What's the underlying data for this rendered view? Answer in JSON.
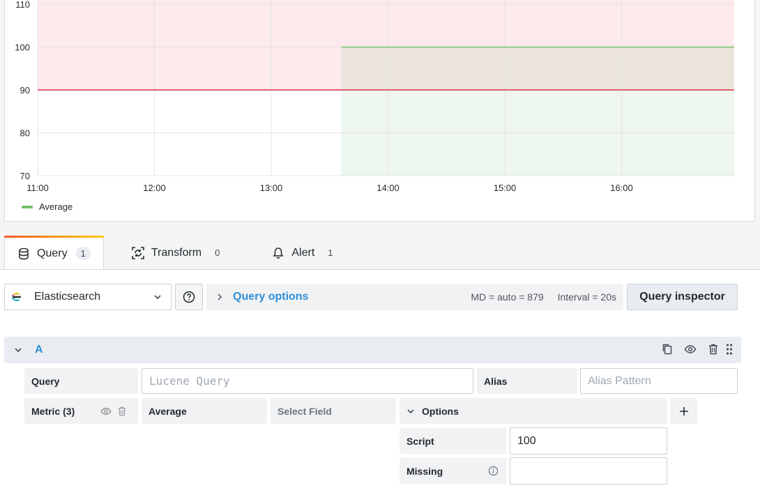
{
  "chart_data": {
    "type": "line",
    "x_ticks": [
      "11:00",
      "12:00",
      "13:00",
      "14:00",
      "15:00",
      "16:00"
    ],
    "y_ticks": [
      70,
      80,
      90,
      100,
      110
    ],
    "ylim": [
      70,
      113
    ],
    "series": [
      {
        "name": "Average",
        "color": "#73bf69",
        "x": [
          "13:36",
          "16:58"
        ],
        "values": [
          100,
          100
        ]
      }
    ],
    "thresholds": [
      {
        "value": 90,
        "color": "#e02f44",
        "fill_above": true
      }
    ],
    "legend": "bottom-left",
    "grid": true
  },
  "tabs": [
    {
      "label": "Query",
      "count": "1",
      "icon": "database-icon",
      "active": true
    },
    {
      "label": "Transform",
      "count": "0",
      "icon": "transform-icon",
      "active": false
    },
    {
      "label": "Alert",
      "count": "1",
      "icon": "bell-icon",
      "active": false
    }
  ],
  "datasource": {
    "name": "Elasticsearch",
    "icon": "elasticsearch-logo"
  },
  "query_options": {
    "label": "Query options",
    "md": "MD = auto = 879",
    "interval": "Interval = 20s"
  },
  "inspector_label": "Query inspector",
  "query_row": {
    "name": "A",
    "query_label": "Query",
    "query_placeholder": "Lucene Query",
    "alias_label": "Alias",
    "alias_placeholder": "Alias Pattern",
    "metric_label": "Metric (3)",
    "metric_type": "Average",
    "metric_field": "Select Field",
    "options_label": "Options",
    "script_label": "Script",
    "script_value": "100",
    "missing_label": "Missing",
    "missing_value": ""
  },
  "colors": {
    "accent": "#2f8fd6",
    "threshold": "#e02f44",
    "series": "#73bf69"
  }
}
